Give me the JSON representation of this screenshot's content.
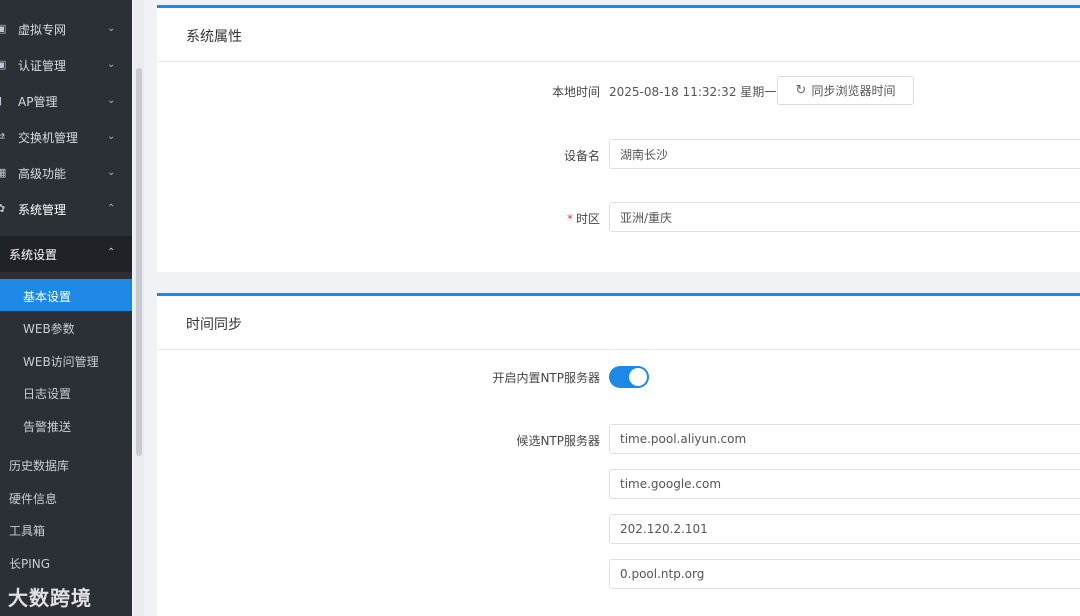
{
  "sidebar": {
    "groups": [
      {
        "label": "虚拟专网",
        "icon": "vpn-icon"
      },
      {
        "label": "认证管理",
        "icon": "auth-icon"
      },
      {
        "label": "AP管理",
        "icon": "ap-icon"
      },
      {
        "label": "交换机管理",
        "icon": "switch-icon"
      },
      {
        "label": "高级功能",
        "icon": "advanced-icon"
      },
      {
        "label": "系统管理",
        "icon": "gear-icon"
      }
    ],
    "sub_header": "系统设置",
    "items": [
      {
        "label": "基本设置"
      },
      {
        "label": "WEB参数"
      },
      {
        "label": "WEB访问管理"
      },
      {
        "label": "日志设置"
      },
      {
        "label": "告警推送"
      }
    ],
    "plain_items": [
      {
        "label": "历史数据库"
      },
      {
        "label": "硬件信息"
      },
      {
        "label": "工具箱"
      },
      {
        "label": "长PING"
      }
    ]
  },
  "system_props": {
    "title": "系统属性",
    "local_time_label": "本地时间",
    "local_time_value": "2025-08-18 11:32:32 星期一",
    "sync_button": "同步浏览器时间",
    "device_name_label": "设备名",
    "device_name_value": "湖南长沙",
    "timezone_label": "时区",
    "timezone_value": "亚洲/重庆"
  },
  "time_sync": {
    "title": "时间同步",
    "ntp_enable_label": "开启内置NTP服务器",
    "ntp_enabled": true,
    "ntp_servers_label": "候选NTP服务器",
    "servers": [
      "time.pool.aliyun.com",
      "time.google.com",
      "202.120.2.101",
      "0.pool.ntp.org"
    ]
  },
  "watermark": "大数跨境",
  "colors": {
    "accent": "#1e88e5",
    "sidebar_bg": "#2b2f36",
    "required": "#e4393c"
  }
}
